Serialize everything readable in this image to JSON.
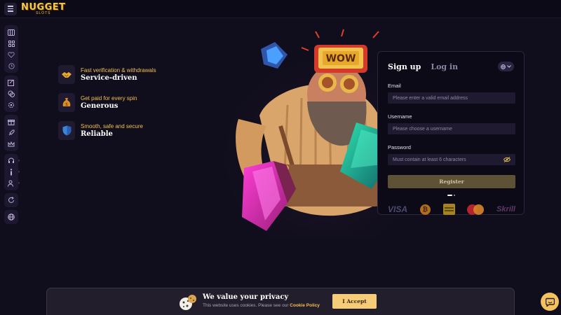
{
  "brand": {
    "logo_main": "NUGGET",
    "logo_sub": "SLOTS"
  },
  "sidebar": {
    "groups": [
      [
        "slots-icon",
        "grid-icon",
        "heart-icon",
        "history-icon"
      ],
      [
        "sports-icon",
        "chips-icon",
        "settings-icon"
      ],
      [
        "gift-icon",
        "rocket-icon",
        "crown-icon"
      ],
      [
        "support-icon",
        "info-icon",
        "users-icon"
      ],
      [
        "refresh-icon"
      ],
      [
        "globe-icon"
      ]
    ]
  },
  "features": [
    {
      "icon": "handshake-icon",
      "subtitle": "Fast verification & withdrawals",
      "title": "Service-driven"
    },
    {
      "icon": "money-bag-icon",
      "subtitle": "Get paid for every spin",
      "title": "Generous"
    },
    {
      "icon": "shield-icon",
      "subtitle": "Smooth, safe and secure",
      "title": "Reliable"
    }
  ],
  "hero": {
    "sign_text": "WOW"
  },
  "auth": {
    "tab_signup": "Sign up",
    "tab_login": "Log in",
    "email_label": "Email",
    "email_placeholder": "Please enter a valid email address",
    "username_label": "Username",
    "username_placeholder": "Please choose a username",
    "password_label": "Password",
    "password_placeholder": "Must contain at least 6 characters",
    "register_label": "Register",
    "payments": {
      "visa": "VISA",
      "skrill": "Skrill"
    }
  },
  "cookie": {
    "title": "We value your privacy",
    "text": "This website uses cookies. Please see our",
    "link": "Cookie Policy",
    "accept": "I Accept"
  },
  "colors": {
    "accent": "#f3c84b",
    "background": "#100d1c",
    "panel": "#0d0a17"
  }
}
